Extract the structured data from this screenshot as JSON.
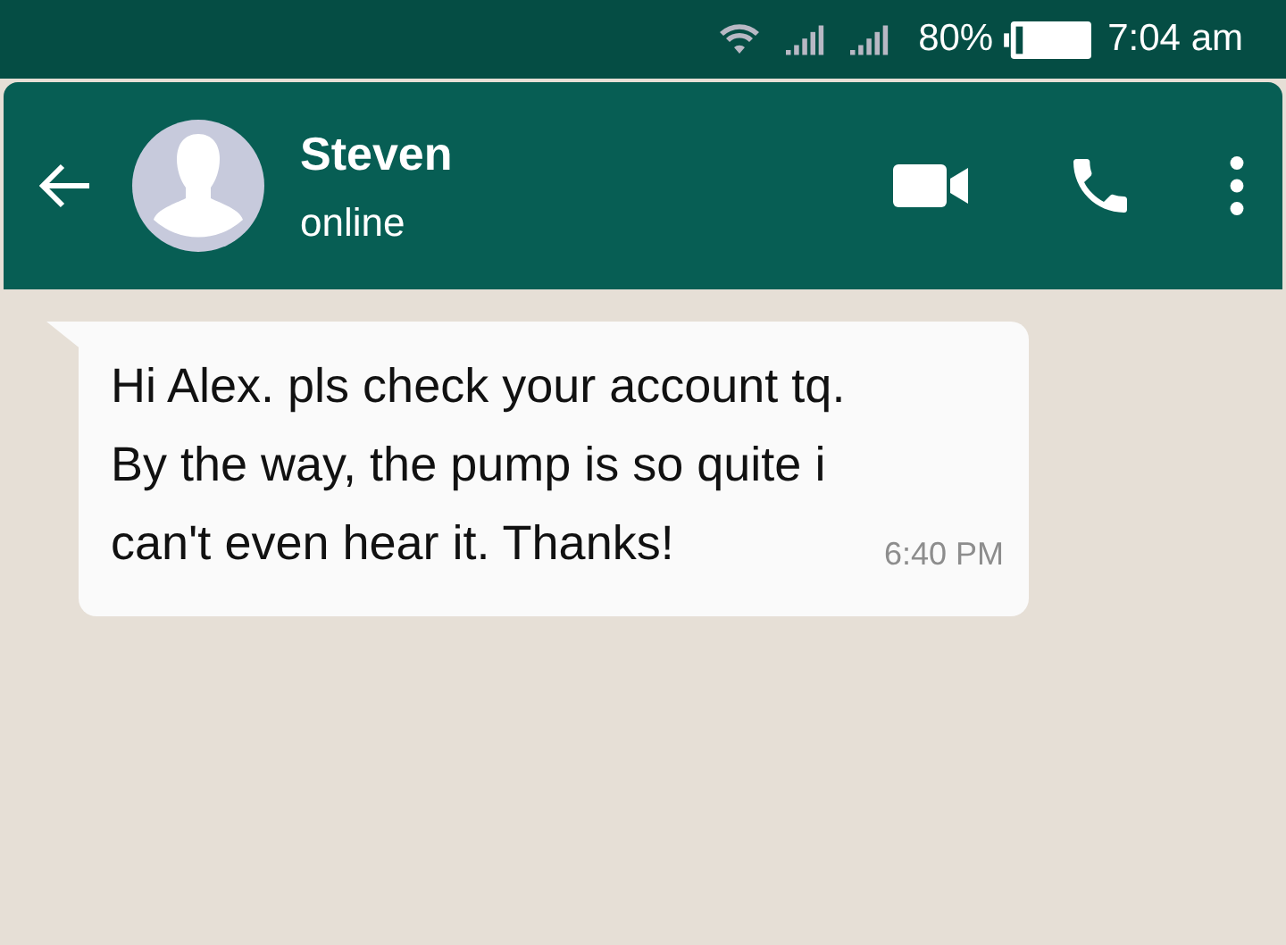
{
  "status_bar": {
    "battery_percent": "80%",
    "time": "7:04 am"
  },
  "header": {
    "contact_name": "Steven",
    "presence": "online"
  },
  "messages": [
    {
      "text": "Hi Alex. pls check your account tq. By the way, the pump is so quite i can't even hear it. Thanks!",
      "time": "6:40 PM"
    }
  ]
}
